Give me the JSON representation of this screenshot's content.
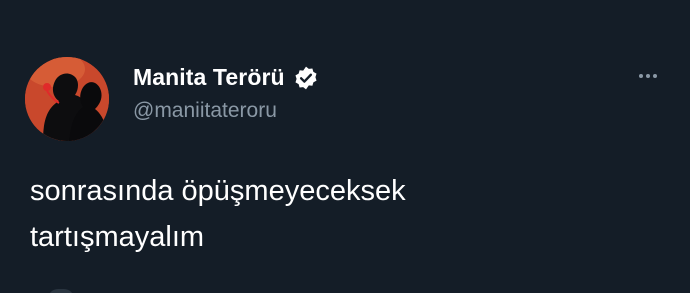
{
  "tweet": {
    "author": {
      "display_name": "Manita Terörü",
      "handle": "@maniitateroru",
      "verified": true,
      "avatar_icon": "profile-photo-silhouette"
    },
    "text_lines": [
      "sonrasında öpüşmeyeceksek",
      "tartışmayalım"
    ],
    "more_icon": "more-horizontal-icon"
  },
  "colors": {
    "background": "#141d27",
    "secondary_text": "#8a98a5",
    "primary_text": "#ffffff",
    "avatar_bg": "#c9482c"
  }
}
